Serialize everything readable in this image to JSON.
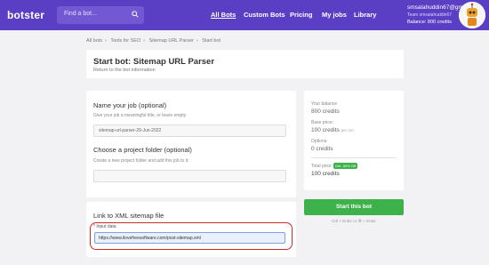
{
  "header": {
    "logo": "botster",
    "search_placeholder": "Find a bot...",
    "nav": [
      {
        "label": "All Bots",
        "active": true
      },
      {
        "label": "Custom Bots",
        "active": false
      },
      {
        "label": "Pricing",
        "active": false
      },
      {
        "label": "My jobs",
        "active": false
      },
      {
        "label": "Library",
        "active": false
      }
    ],
    "account": {
      "email": "smsalahuddin67@gma...",
      "team": "Team smsalahuddin67",
      "balance": "Balance: 800 credits"
    }
  },
  "breadcrumb": [
    "All bots",
    "Tools for SEO",
    "Sitemap URL Parser",
    "Start bot"
  ],
  "title_card": {
    "title": "Start bot: Sitemap URL Parser",
    "back_link": "Return to the bot information"
  },
  "form": {
    "job_name_label": "Name your job (optional)",
    "job_name_help": "Give your job a meaningful title, or leave empty",
    "job_name_value": "sitemap-url-parser-29-Jun-2022",
    "folder_label": "Choose a project folder (optional)",
    "folder_help": "Create a new project folder and add this job to it:",
    "folder_value": ""
  },
  "sitemap": {
    "label": "Link to XML sitemap file",
    "input_required_mark": "*",
    "input_label": "Input data",
    "input_value": "https://www.ilovefreesoftware.com/post-sitemap.xml"
  },
  "side": {
    "balance_label": "Your balance",
    "balance_value": "800 credits",
    "base_price_label": "Base price:",
    "base_price_value": "100 credits",
    "base_price_unit": "per run",
    "options_label": "Options:",
    "options_value": "0 credits",
    "total_label": "Total price",
    "discount_badge": "Get -30% Off",
    "total_value": "100 credits",
    "start_label": "Start this bot",
    "shortcut_hint": "Ctrl + Enter or ⌘ + Enter"
  },
  "colors": {
    "header_bg": "#5a3fc4",
    "accent_green": "#3db14a",
    "highlight_red": "#d02b2b"
  }
}
